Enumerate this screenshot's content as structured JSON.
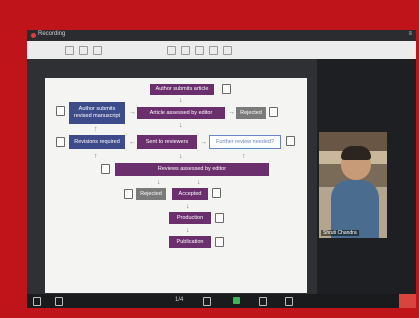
{
  "window": {
    "title": "Recording",
    "menu": "≡"
  },
  "flowchart": {
    "author_submits_article": "Author submits article",
    "author_submits_revised": "Author submits revised manuscript",
    "article_assessed": "Article assessed by editor",
    "rejected_top": "Rejected",
    "revisions_required": "Revisions required",
    "sent_to_reviewers": "Sent to reviewers",
    "further_review": "Further review needed?",
    "reviews_assessed": "Reviews assessed by editor",
    "rejected_bottom": "Rejected",
    "accepted": "Accepted",
    "production": "Production",
    "publication": "Publication"
  },
  "participant": {
    "name": "Shruti Chandra"
  },
  "bottom_bar": {
    "page": "1/4"
  },
  "colors": {
    "frame": "#c0141b",
    "purple": "#6b2f6e",
    "indigo": "#3e4b8a"
  }
}
